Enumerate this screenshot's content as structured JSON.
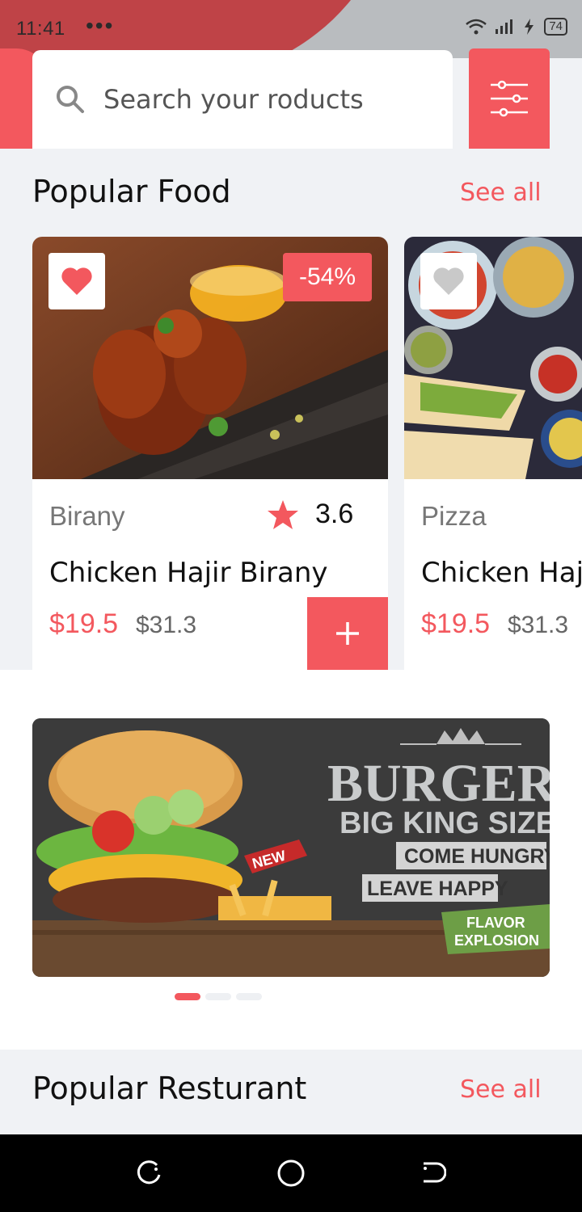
{
  "status_bar": {
    "time": "11:41",
    "dots": "•••",
    "battery": "74"
  },
  "search": {
    "placeholder": "Search your roducts"
  },
  "popular_food": {
    "title": "Popular Food",
    "see_all": "See all",
    "cards": [
      {
        "discount": "-54%",
        "category": "Birany",
        "rating": "3.6",
        "name": "Chicken Hajir Birany",
        "price": "$19.5",
        "old_price": "$31.3",
        "favorited": true
      },
      {
        "category": "Pizza",
        "name": "Chicken Hajir Birany",
        "price": "$19.5",
        "old_price": "$31.3",
        "favorited": false
      }
    ]
  },
  "banner": {
    "headline": "BURGER",
    "subline": "BIG KING SIZE",
    "tag1": "COME HUNGRY",
    "tag2": "LEAVE HAPPY",
    "ribbon": "NEW",
    "badge_line1": "FLAVOR",
    "badge_line2": "EXPLOSION",
    "pages": 3,
    "active_page": 1
  },
  "popular_restaurant": {
    "title": "Popular Resturant",
    "see_all": "See all"
  },
  "colors": {
    "accent": "#f3585e",
    "section_bg": "#f0f2f5"
  },
  "icons": [
    "search-icon",
    "filter-sliders-icon",
    "heart-icon",
    "star-icon",
    "plus-icon",
    "recent-apps-icon",
    "home-icon",
    "back-icon"
  ]
}
